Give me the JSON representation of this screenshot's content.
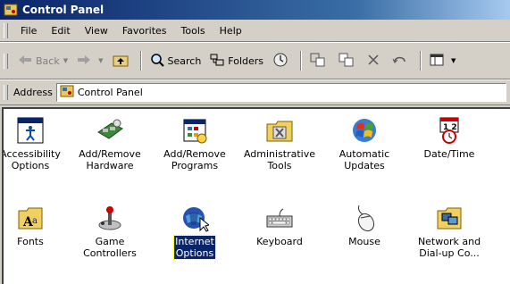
{
  "window": {
    "title": "Control Panel"
  },
  "menu": [
    "File",
    "Edit",
    "View",
    "Favorites",
    "Tools",
    "Help"
  ],
  "toolbar": {
    "back": "Back",
    "search": "Search",
    "folders": "Folders"
  },
  "address": {
    "label": "Address",
    "value": "Control Panel"
  },
  "items": [
    {
      "line1": "Accessibility",
      "line2": "Options",
      "icon": "accessibility-icon"
    },
    {
      "line1": "Add/Remove",
      "line2": "Hardware",
      "icon": "hardware-icon"
    },
    {
      "line1": "Add/Remove",
      "line2": "Programs",
      "icon": "programs-icon"
    },
    {
      "line1": "Administrative",
      "line2": "Tools",
      "icon": "admin-tools-icon"
    },
    {
      "line1": "Automatic",
      "line2": "Updates",
      "icon": "updates-icon"
    },
    {
      "line1": "Date/Time",
      "line2": "",
      "icon": "clock-icon"
    },
    {
      "line1": "Fonts",
      "line2": "",
      "icon": "fonts-icon"
    },
    {
      "line1": "Game",
      "line2": "Controllers",
      "icon": "joystick-icon"
    },
    {
      "line1": "Internet",
      "line2": "Options",
      "icon": "internet-icon",
      "selected": true
    },
    {
      "line1": "Keyboard",
      "line2": "",
      "icon": "keyboard-icon"
    },
    {
      "line1": "Mouse",
      "line2": "",
      "icon": "mouse-icon"
    },
    {
      "line1": "Network and",
      "line2": "Dial-up Co...",
      "icon": "network-icon"
    }
  ]
}
